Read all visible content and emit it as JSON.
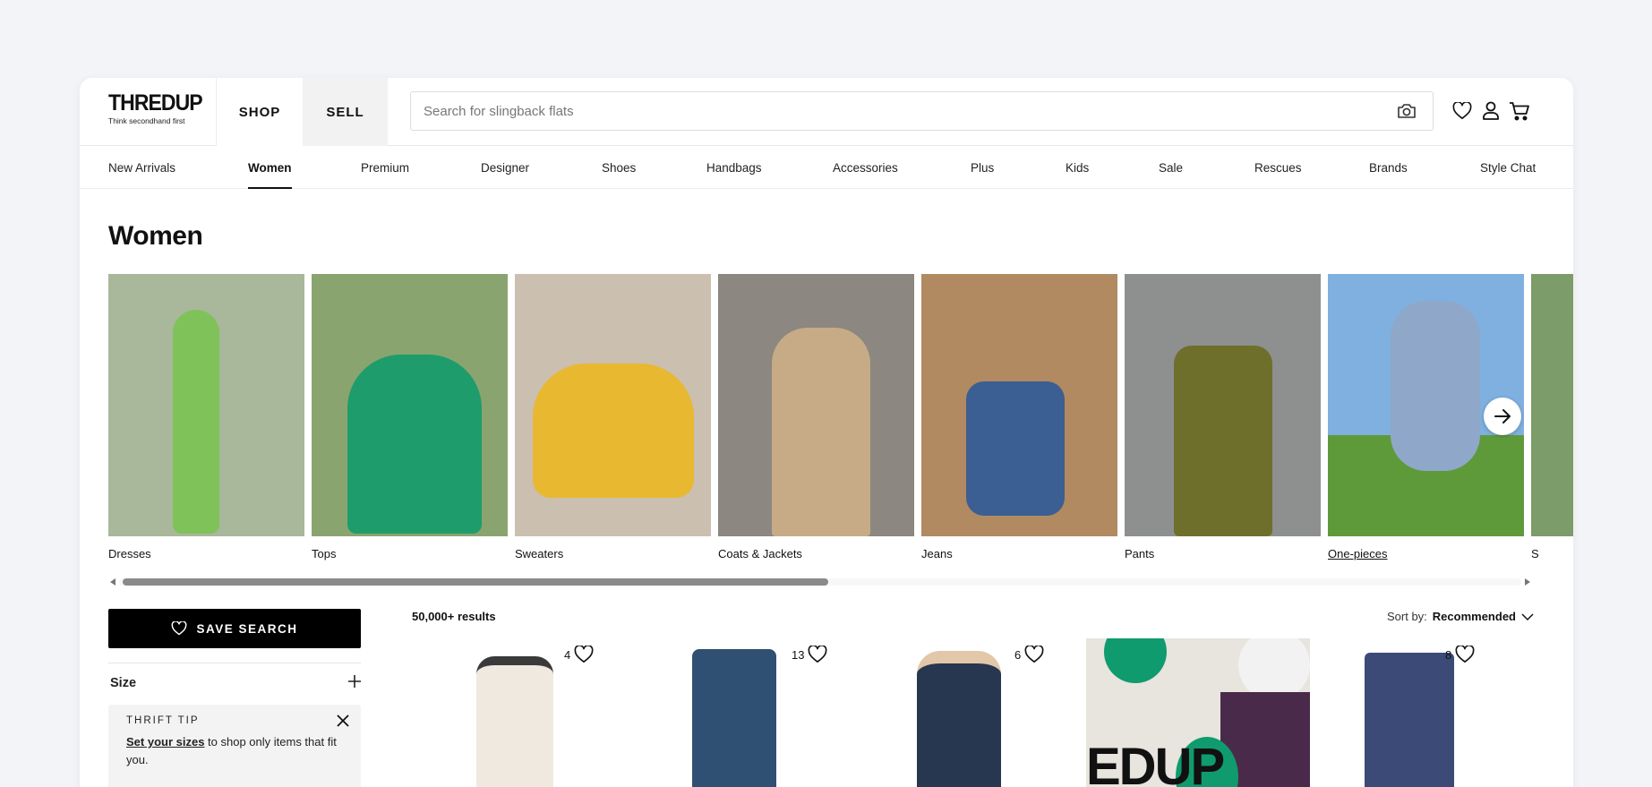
{
  "header": {
    "logo_word": "THREDUP",
    "logo_tagline": "Think secondhand first",
    "tabs": [
      {
        "label": "SHOP"
      },
      {
        "label": "SELL"
      }
    ],
    "search_placeholder": "Search for slingback flats",
    "icons": [
      "camera-icon",
      "heart-icon",
      "user-icon",
      "cart-icon"
    ]
  },
  "nav": {
    "items": [
      {
        "label": "New Arrivals"
      },
      {
        "label": "Women"
      },
      {
        "label": "Premium"
      },
      {
        "label": "Designer"
      },
      {
        "label": "Shoes"
      },
      {
        "label": "Handbags"
      },
      {
        "label": "Accessories"
      },
      {
        "label": "Plus"
      },
      {
        "label": "Kids"
      },
      {
        "label": "Sale"
      },
      {
        "label": "Rescues"
      },
      {
        "label": "Brands"
      },
      {
        "label": "Style Chat"
      }
    ],
    "active": "Women"
  },
  "page": {
    "title": "Women"
  },
  "categories": [
    {
      "label": "Dresses",
      "bg": "#a9b79a",
      "figure": "#7fc25a"
    },
    {
      "label": "Tops",
      "bg": "#8aa470",
      "figure": "#1f9c6b"
    },
    {
      "label": "Sweaters",
      "bg": "#cbbfb0",
      "figure": "#e8b830"
    },
    {
      "label": "Coats & Jackets",
      "bg": "#8c8780",
      "figure": "#c6ab86"
    },
    {
      "label": "Jeans",
      "bg": "#b18a62",
      "figure": "#3b5f92"
    },
    {
      "label": "Pants",
      "bg": "#8e8f8f",
      "figure": "#6f6f2c"
    },
    {
      "label": "One-pieces",
      "bg": "#7fb0e0",
      "figure": "#8fa8c9"
    },
    {
      "label": "S",
      "bg": "#7c9c6a",
      "figure": "#6b8a5a"
    }
  ],
  "sidebar": {
    "save_search": "SAVE SEARCH",
    "size_label": "Size",
    "tip_title": "THRIFT TIP",
    "tip_link": "Set your sizes",
    "tip_text": " to shop only items that fit you."
  },
  "results": {
    "count": "50,000+ results",
    "sort_label": "Sort by:",
    "sort_value": "Recommended"
  },
  "products": [
    {
      "likes": "4",
      "color": "#efe9df"
    },
    {
      "likes": "13",
      "color": "#2f4f73"
    },
    {
      "likes": "6",
      "color": "#26374f"
    },
    {
      "likes": "",
      "color": "#0f9b6e"
    },
    {
      "likes": "8",
      "color": "#3c4a78"
    }
  ]
}
